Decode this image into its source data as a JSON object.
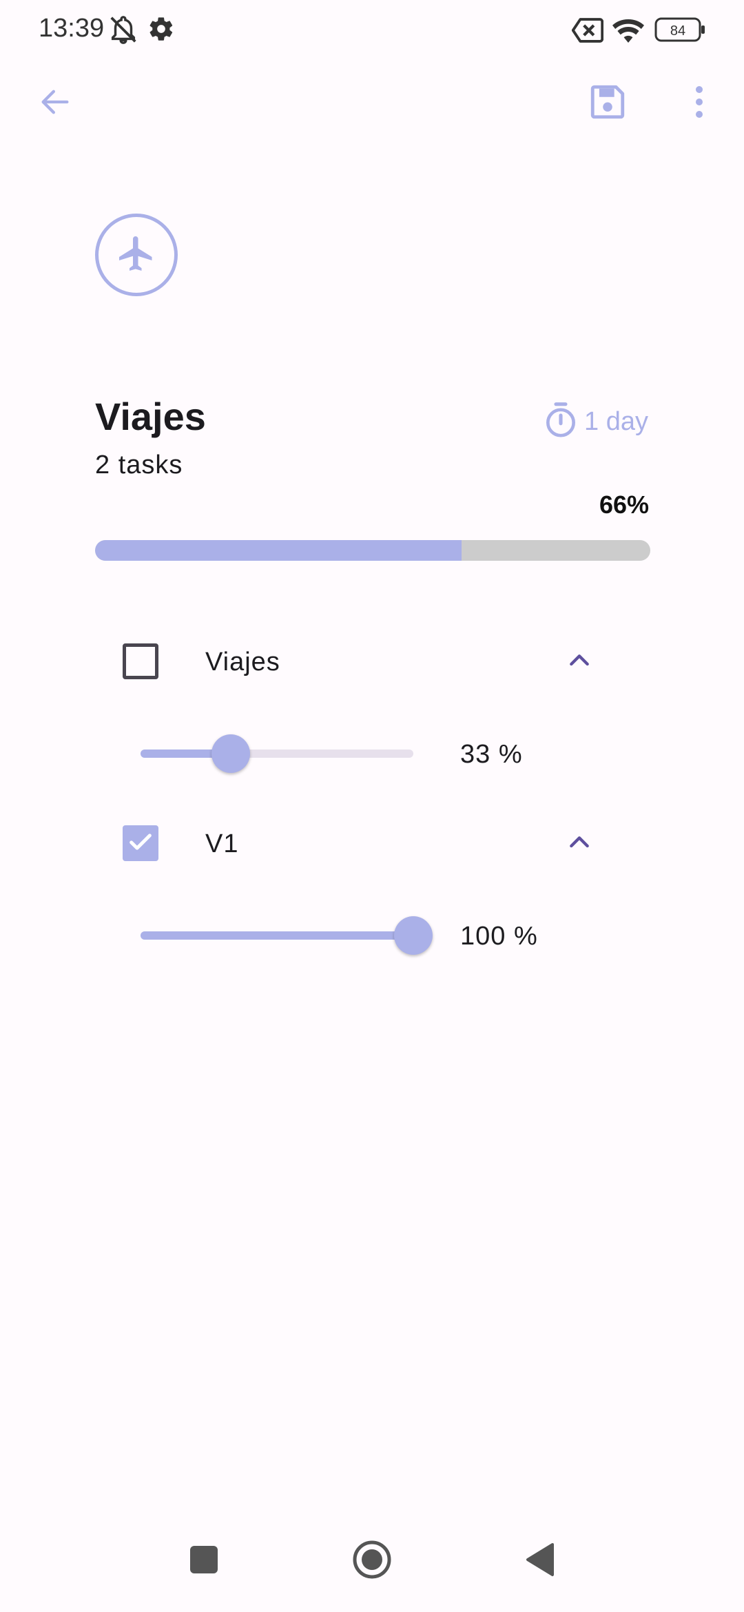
{
  "status_bar": {
    "time": "13:39",
    "battery": "84",
    "icons": [
      "muted-bell-icon",
      "settings-gear-icon",
      "no-sim-icon",
      "wifi-icon",
      "battery-icon"
    ]
  },
  "app_bar": {
    "icons": [
      "back-arrow-icon",
      "save-icon",
      "more-vert-icon"
    ],
    "accent_color": "#aab0e8"
  },
  "header": {
    "category_icon": "airplane-icon",
    "title": "Viajes",
    "task_count": "2 tasks",
    "duration": "1 day",
    "progress_label": "66%",
    "progress_fraction": 0.66
  },
  "tasks": [
    {
      "label": "Viajes",
      "checked": false,
      "progress_label": "33 %",
      "progress_fraction": 0.33
    },
    {
      "label": "V1",
      "checked": true,
      "progress_label": "100 %",
      "progress_fraction": 1.0
    }
  ],
  "nav_bar": {
    "icons": [
      "recents-square-icon",
      "home-circle-icon",
      "back-triangle-icon"
    ]
  },
  "colors": {
    "accent": "#aab0e8",
    "track": "#cccccc",
    "chevron": "#5e4f9e",
    "background": "#fffbfe"
  }
}
